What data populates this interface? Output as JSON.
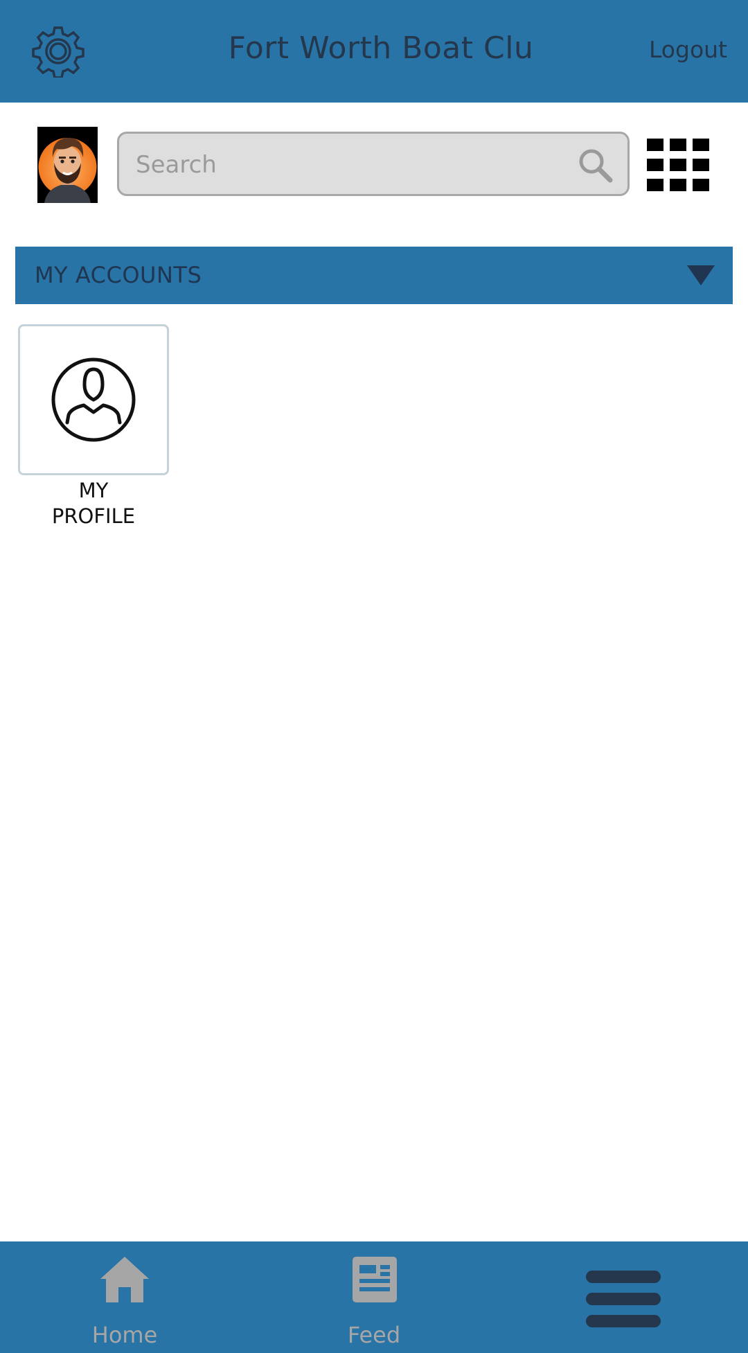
{
  "header": {
    "title": "Fort Worth Boat Clu",
    "logout_label": "Logout",
    "settings_icon": "gear-icon"
  },
  "search": {
    "placeholder": "Search",
    "value": ""
  },
  "accordion": {
    "label": "MY ACCOUNTS"
  },
  "tiles": [
    {
      "label_line1": "MY",
      "label_line2": "PROFILE",
      "icon": "user-circle-icon"
    }
  ],
  "bottom_nav": {
    "home_label": "Home",
    "feed_label": "Feed",
    "menu_icon": "hamburger-menu-icon"
  },
  "colors": {
    "brand": "#2874a6",
    "text_dark": "#24374d",
    "nav_inactive": "#a6a6a6"
  }
}
